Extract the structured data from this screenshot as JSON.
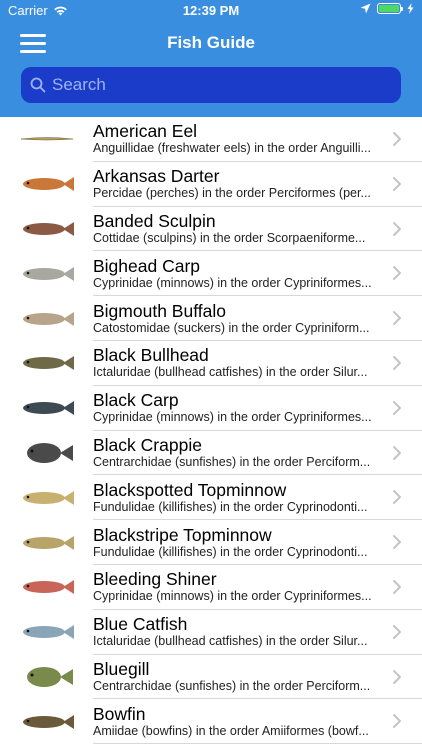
{
  "status": {
    "carrier": "Carrier",
    "time": "12:39 PM"
  },
  "nav": {
    "title": "Fish Guide"
  },
  "search": {
    "placeholder": "Search"
  },
  "fish": [
    {
      "name": "American Eel",
      "subtitle": "Anguillidae (freshwater eels) in the order Anguilli...",
      "icon": "eel",
      "color": "#b8a060"
    },
    {
      "name": "Arkansas Darter",
      "subtitle": "Percidae (perches) in the order Perciformes (per...",
      "icon": "darter",
      "color": "#c9783a"
    },
    {
      "name": "Banded Sculpin",
      "subtitle": "Cottidae (sculpins) in the order Scorpaeniforme...",
      "icon": "sculpin",
      "color": "#8a5a44"
    },
    {
      "name": "Bighead Carp",
      "subtitle": "Cyprinidae (minnows) in the order Cypriniformes...",
      "icon": "carp",
      "color": "#a8a8a0"
    },
    {
      "name": "Bigmouth Buffalo",
      "subtitle": "Catostomidae (suckers) in the order Cypriniform...",
      "icon": "buffalo",
      "color": "#b8a48a"
    },
    {
      "name": "Black Bullhead",
      "subtitle": "Ictaluridae (bullhead catfishes) in the order Silur...",
      "icon": "bullhead",
      "color": "#6e6a48"
    },
    {
      "name": "Black Carp",
      "subtitle": "Cyprinidae (minnows) in the order Cypriniformes...",
      "icon": "black-carp",
      "color": "#3e4a52"
    },
    {
      "name": "Black Crappie",
      "subtitle": "Centrarchidae (sunfishes) in the order Perciform...",
      "icon": "crappie",
      "color": "#4a4a4a"
    },
    {
      "name": "Blackspotted Topminnow",
      "subtitle": "Fundulidae (killifishes) in the order Cyprinodonti...",
      "icon": "topminnow",
      "color": "#c8b070"
    },
    {
      "name": "Blackstripe Topminnow",
      "subtitle": "Fundulidae (killifishes) in the order Cyprinodonti...",
      "icon": "topminnow-stripe",
      "color": "#b8a468"
    },
    {
      "name": "Bleeding Shiner",
      "subtitle": "Cyprinidae (minnows) in the order Cypriniformes...",
      "icon": "shiner",
      "color": "#c86458"
    },
    {
      "name": "Blue Catfish",
      "subtitle": "Ictaluridae (bullhead catfishes) in the order Silur...",
      "icon": "catfish",
      "color": "#8aa4b8"
    },
    {
      "name": "Bluegill",
      "subtitle": "Centrarchidae (sunfishes) in the order Perciform...",
      "icon": "bluegill",
      "color": "#7a8a4a"
    },
    {
      "name": "Bowfin",
      "subtitle": "Amiidae (bowfins) in the order Amiiformes (bowf...",
      "icon": "bowfin",
      "color": "#6a5a3a"
    }
  ]
}
